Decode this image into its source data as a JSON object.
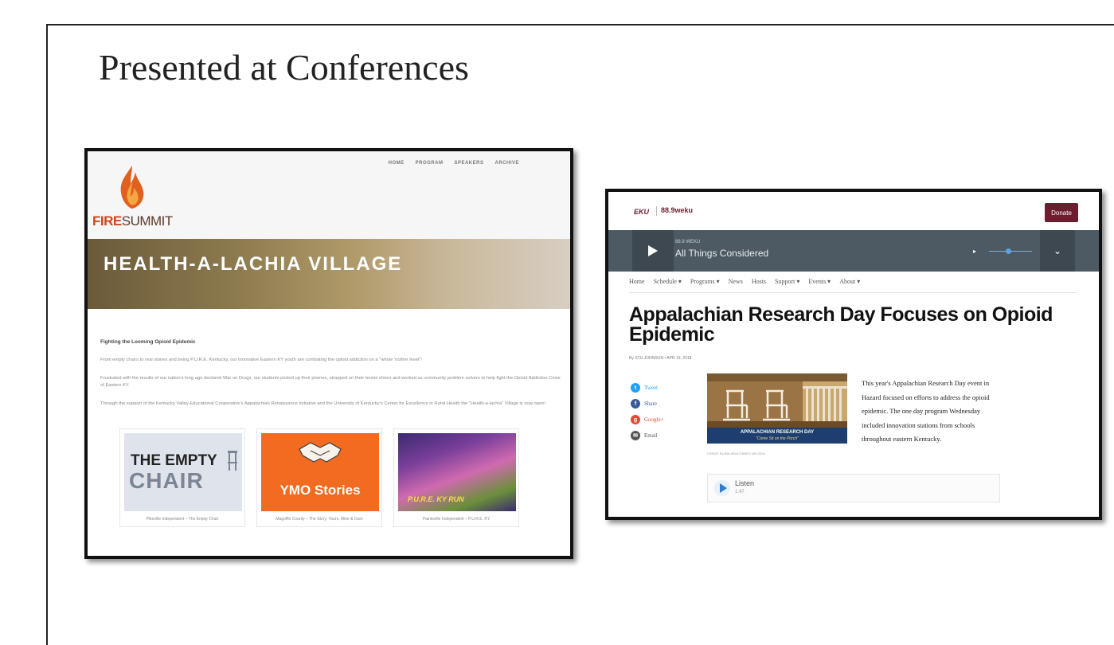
{
  "slide": {
    "title": "Presented at Conferences"
  },
  "fire_summit": {
    "logo": {
      "fire": "FIRE",
      "summit": "SUMMIT"
    },
    "nav": [
      "HOME",
      "PROGRAM",
      "SPEAKERS",
      "ARCHIVE"
    ],
    "banner_title": "HEALTH-A-LACHIA VILLAGE",
    "heading": "Fighting the Looming Opioid Epidemic",
    "paragraphs": [
      "From empty chairs to real stories and being P.U.R.E. Kentucky, our innovative Eastern KY youth are combating the opioid addiction on a \"whole 'nother level\"!",
      "Frustrated with the results of our nation's long ago declared War on Drugs, our students picked up their phones, strapped on their tennis shoes and worked as community problem solvers to help fight the Opioid Addiction Crisis of Eastern KY.",
      "Through the support of the Kentucky Valley Educational Cooperative's Appalachian Renaissance Initiative and the University of Kentucky's Center for Excellence in Rural Health the \"Health-a-lachia\" Village is now open!"
    ],
    "cards": [
      {
        "image_text_1": "THE EMPTY",
        "image_text_2": "CHAIR",
        "caption": "Pikeville Independent – The Empty Chair"
      },
      {
        "image_text": "YMO Stories",
        "caption": "Magoffin County – The Story: Yours, Mine & Ours"
      },
      {
        "image_text": "P.U.R.E. KY RUN",
        "caption": "Paintsville Independent – P.U.R.E. KY"
      }
    ]
  },
  "weku": {
    "eku_logo": "EKU",
    "station_logo": "88.9weku",
    "donate_label": "Donate",
    "player": {
      "station": "88.9 WEKU",
      "program": "All Things Considered"
    },
    "nav": [
      "Home",
      "Schedule ▾",
      "Programs ▾",
      "News",
      "Hosts",
      "Support ▾",
      "Events ▾",
      "About ▾"
    ],
    "headline": "Appalachian Research Day Focuses on Opioid Epidemic",
    "byline": "By STU JOHNSON • APR 19, 2018",
    "share": [
      {
        "label": "Tweet",
        "icon": "twitter-icon",
        "color": "#1da1f2",
        "glyph": "t"
      },
      {
        "label": "Share",
        "icon": "facebook-icon",
        "color": "#3b5998",
        "glyph": "f"
      },
      {
        "label": "Google+",
        "icon": "google-plus-icon",
        "color": "#dd4b39",
        "glyph": "g"
      },
      {
        "label": "Email",
        "icon": "email-icon",
        "color": "#555555",
        "glyph": "✉"
      }
    ],
    "photo": {
      "banner_title": "APPALACHIAN RESEARCH DAY",
      "banner_subtitle": "\"Come Sit on the Porch\"",
      "credit": "CREDIT RURALHEALTHINFO.UKY.EDU"
    },
    "article": "This year's Appalachian Research Day event in Hazard focused on efforts to address the opioid epidemic.  The one day program Wednesday included innovation stations from schools throughout eastern Kentucky.",
    "listen": {
      "label": "Listen",
      "duration": "1:47"
    }
  },
  "colors": {
    "fire_orange": "#d4461b",
    "weku_maroon": "#6b1e2d",
    "player_bg": "#4d5a63",
    "ymo_orange": "#f36a21"
  }
}
